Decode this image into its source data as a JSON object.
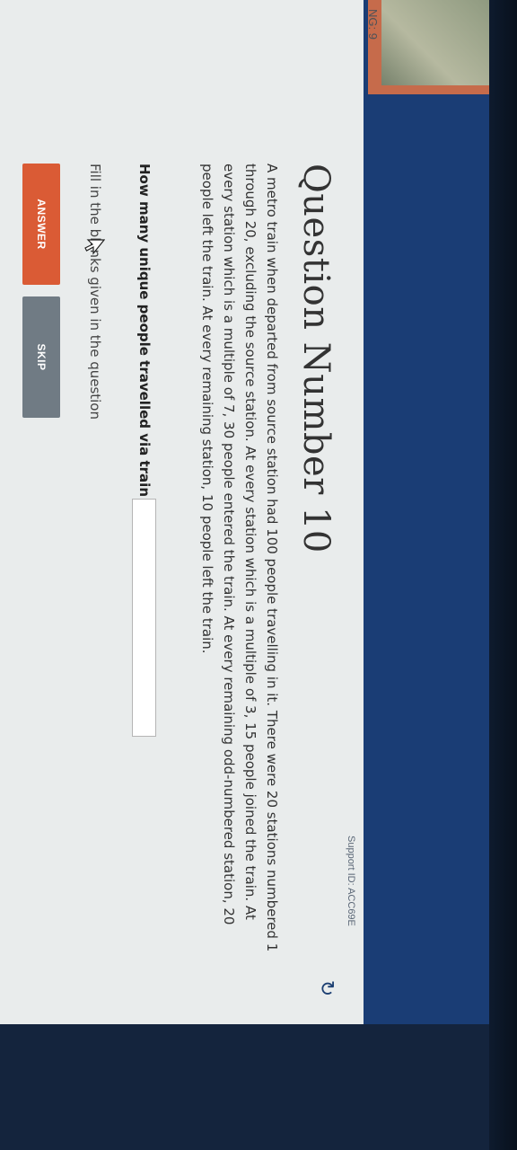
{
  "header": {
    "stage_label": "NG: 9"
  },
  "support": {
    "id_text": "Support ID: ACC69E"
  },
  "icons": {
    "refresh": "refresh-icon",
    "cursor": "mouse-pointer-icon"
  },
  "question": {
    "title": "Question Number 10",
    "text": "A metro train when departed from source station had 100 people travelling in it. There were 20 stations numbered 1 through 20, excluding the source station. At every station which is a multiple of 3, 15 people joined the train. At every station which is a multiple of 7, 30 people entered the train. At every remaining odd-numbered station, 20 people left the train. At every remaining station, 10 people left the train.",
    "blank_label": "How many unique people travelled via train",
    "answer_value": "",
    "fill_note": "Fill in the blanks given in the question"
  },
  "actions": {
    "answer_label": "ANSWER",
    "skip_label": "SKIP"
  },
  "colors": {
    "header_blue": "#1a3d75",
    "answer_orange": "#da5b35",
    "skip_gray": "#707b84"
  }
}
